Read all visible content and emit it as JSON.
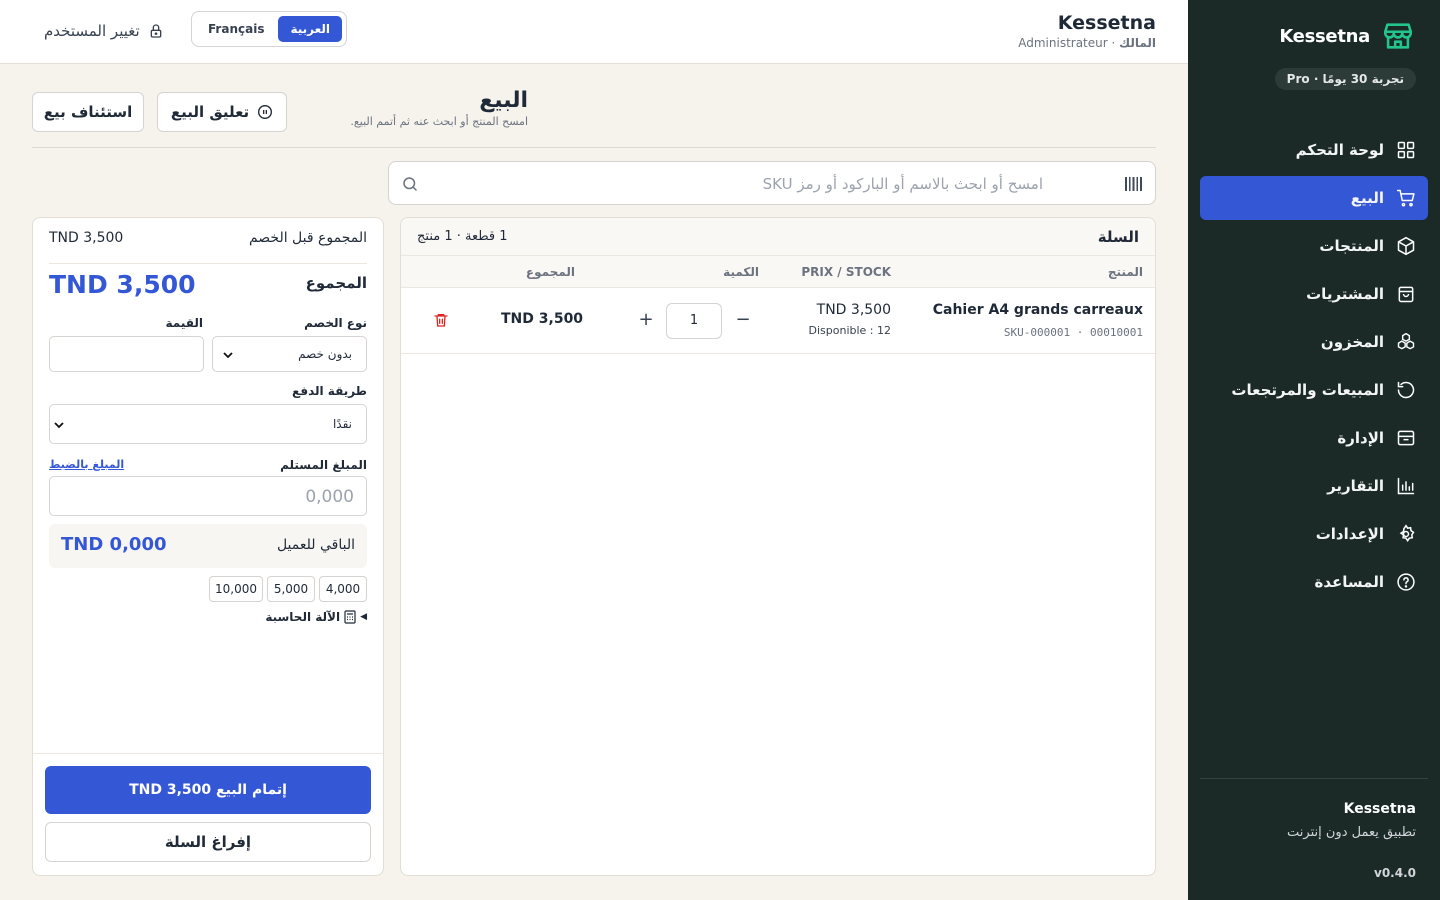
{
  "app": {
    "name": "Kessetna",
    "role": "المالك",
    "role_fr": "Administrateur",
    "trial": "تجربة 30 يومًا · Pro"
  },
  "lang": {
    "fr": "Français",
    "ar": "العربية"
  },
  "switch_user": "تغيير المستخدم",
  "sidebar": {
    "items": [
      {
        "label": "لوحة التحكم",
        "icon": "dashboard-icon"
      },
      {
        "label": "البيع",
        "icon": "cart-icon"
      },
      {
        "label": "المنتجات",
        "icon": "box-icon"
      },
      {
        "label": "المشتريات",
        "icon": "bag-icon"
      },
      {
        "label": "المخزون",
        "icon": "boxes-icon"
      },
      {
        "label": "المبيعات والمرتجعات",
        "icon": "return-icon"
      },
      {
        "label": "الإدارة",
        "icon": "archive-icon"
      },
      {
        "label": "التقارير",
        "icon": "chart-icon"
      },
      {
        "label": "الإعدادات",
        "icon": "gear-icon"
      },
      {
        "label": "المساعدة",
        "icon": "help-icon"
      }
    ],
    "footer": {
      "name": "Kessetna",
      "desc": "تطبيق يعمل دون إنترنت",
      "version": "v0.4.0"
    }
  },
  "page": {
    "title": "البيع",
    "subtitle": "امسح المنتج أو ابحث عنه ثم أتمم البيع.",
    "suspend": "تعليق البيع",
    "resume": "استئناف بيع"
  },
  "search": {
    "placeholder": "امسح أو ابحث بالاسم أو الباركود أو رمز SKU"
  },
  "cart": {
    "title": "السلة",
    "count": "1 قطعة · 1 منتج",
    "columns": {
      "product": "المنتج",
      "price": "PRIX / STOCK",
      "qty": "الكمية",
      "total": "المجموع"
    },
    "rows": [
      {
        "name": "Cahier A4 grands carreaux",
        "sku": "SKU-000001 · 00010001",
        "price": "TND 3,500",
        "stock": "Disponible : 12",
        "qty": "1",
        "total": "TND 3,500"
      }
    ]
  },
  "checkout": {
    "subtotal_label": "المجموع قبل الخصم",
    "subtotal": "TND 3,500",
    "total_label": "المجموع",
    "total": "TND 3,500",
    "discount_type_label": "نوع الخصم",
    "discount_type": "بدون خصم",
    "value_label": "القيمة",
    "payment_label": "طريقة الدفع",
    "payment": "نقدًا",
    "received_label": "المبلغ المستلم",
    "exact_link": "المبلغ بالضبط",
    "received_placeholder": "0,000",
    "change_label": "الباقي للعميل",
    "change": "TND 0,000",
    "chips": [
      "4,000",
      "5,000",
      "10,000"
    ],
    "calculator": "الآلة الحاسبة",
    "complete": "إتمام البيع TND 3,500",
    "clear": "إفراغ السلة"
  }
}
